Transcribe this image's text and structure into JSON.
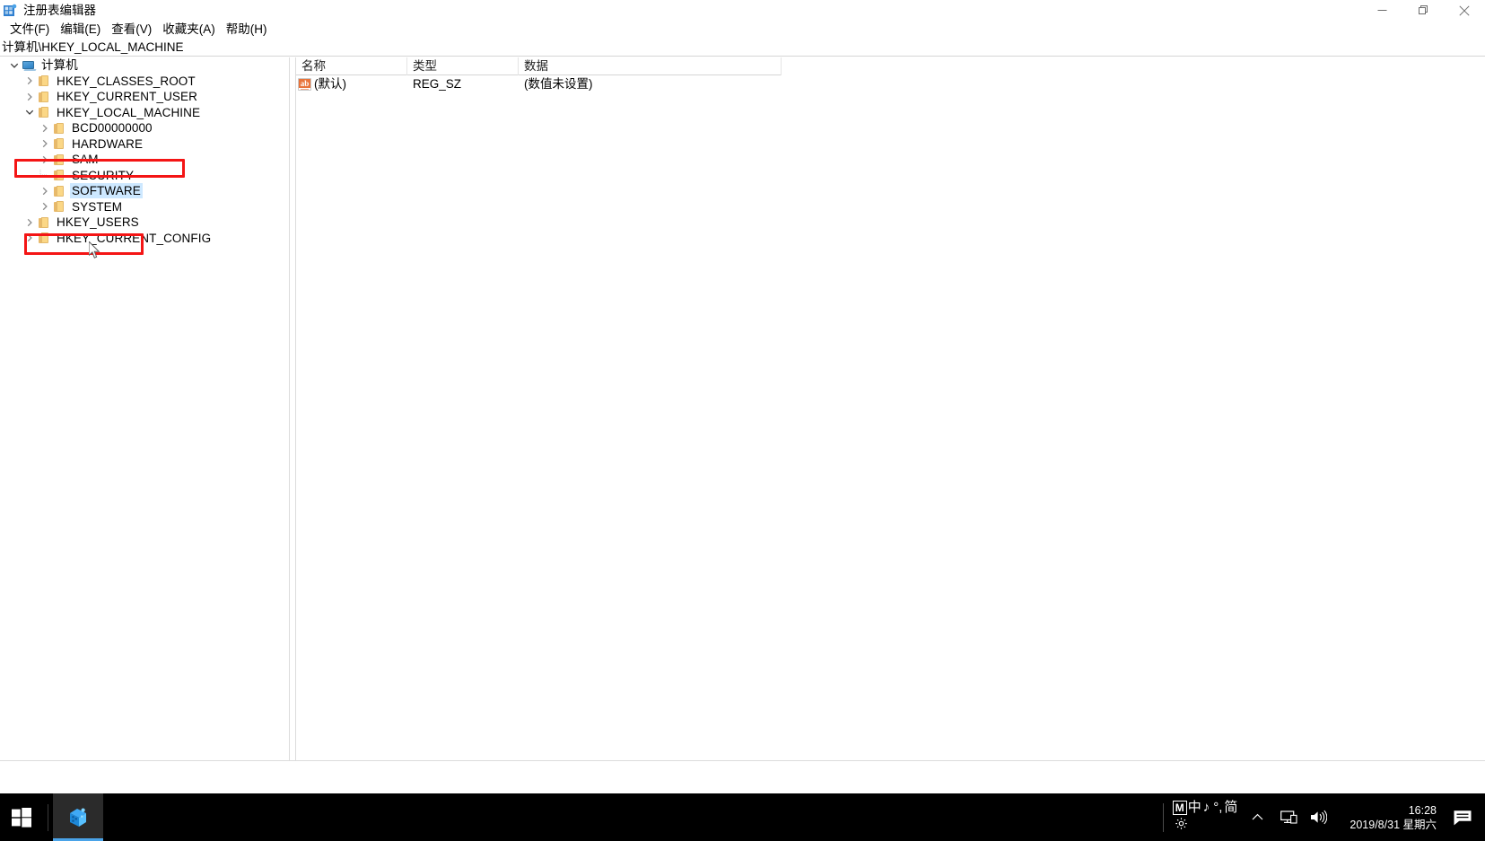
{
  "window": {
    "title": "注册表编辑器",
    "icon": "registry-editor-icon",
    "controls": {
      "minimize": "最小化",
      "restore": "还原",
      "close": "关闭"
    }
  },
  "menubar": {
    "items": [
      {
        "label": "文件(F)",
        "name": "menu-file"
      },
      {
        "label": "编辑(E)",
        "name": "menu-edit"
      },
      {
        "label": "查看(V)",
        "name": "menu-view"
      },
      {
        "label": "收藏夹(A)",
        "name": "menu-favorites"
      },
      {
        "label": "帮助(H)",
        "name": "menu-help"
      }
    ]
  },
  "address": {
    "path": "计算机\\HKEY_LOCAL_MACHINE"
  },
  "tree": {
    "nodes": [
      {
        "label": "计算机",
        "depth": 0,
        "icon": "computer-icon",
        "expanded": true,
        "has_children": true,
        "selected": false
      },
      {
        "label": "HKEY_CLASSES_ROOT",
        "depth": 1,
        "icon": "folder-icon",
        "expanded": false,
        "has_children": true,
        "selected": false
      },
      {
        "label": "HKEY_CURRENT_USER",
        "depth": 1,
        "icon": "folder-icon",
        "expanded": false,
        "has_children": true,
        "selected": false
      },
      {
        "label": "HKEY_LOCAL_MACHINE",
        "depth": 1,
        "icon": "folder-icon",
        "expanded": true,
        "has_children": true,
        "selected": false
      },
      {
        "label": "BCD00000000",
        "depth": 2,
        "icon": "folder-icon",
        "expanded": false,
        "has_children": true,
        "selected": false
      },
      {
        "label": "HARDWARE",
        "depth": 2,
        "icon": "folder-icon",
        "expanded": false,
        "has_children": true,
        "selected": false
      },
      {
        "label": "SAM",
        "depth": 2,
        "icon": "folder-icon",
        "expanded": false,
        "has_children": true,
        "selected": false
      },
      {
        "label": "SECURITY",
        "depth": 2,
        "icon": "folder-icon",
        "expanded": false,
        "has_children": false,
        "selected": false
      },
      {
        "label": "SOFTWARE",
        "depth": 2,
        "icon": "folder-icon",
        "expanded": false,
        "has_children": true,
        "selected": true
      },
      {
        "label": "SYSTEM",
        "depth": 2,
        "icon": "folder-icon",
        "expanded": false,
        "has_children": true,
        "selected": false
      },
      {
        "label": "HKEY_USERS",
        "depth": 1,
        "icon": "folder-icon",
        "expanded": false,
        "has_children": true,
        "selected": false
      },
      {
        "label": "HKEY_CURRENT_CONFIG",
        "depth": 1,
        "icon": "folder-icon",
        "expanded": false,
        "has_children": true,
        "selected": false
      }
    ]
  },
  "list": {
    "columns": [
      {
        "label": "名称",
        "name": "column-header-name"
      },
      {
        "label": "类型",
        "name": "column-header-type"
      },
      {
        "label": "数据",
        "name": "column-header-data"
      }
    ],
    "rows": [
      {
        "name": "(默认)",
        "type": "REG_SZ",
        "data": "(数值未设置)",
        "icon": "string-value-icon"
      }
    ]
  },
  "annotations": [
    {
      "name": "annotation-hklm",
      "target": "HKEY_LOCAL_MACHINE",
      "color": "#f41515"
    },
    {
      "name": "annotation-software",
      "target": "SOFTWARE",
      "color": "#f41515"
    }
  ],
  "taskbar": {
    "start_label": "开始",
    "apps": [
      {
        "label": "注册表编辑器",
        "icon": "registry-editor-icon",
        "active": true
      }
    ],
    "tray": {
      "ime": {
        "mode_box": "M",
        "language": "中",
        "music": "♪",
        "symbol": "°,",
        "script": "简",
        "settings_icon": "gear-icon"
      },
      "overflow_label": "显示隐藏的图标",
      "network_icon": "monitor-network-icon",
      "volume_icon": "speaker-icon",
      "time": "16:28",
      "date": "2019/8/31 星期六",
      "action_center_icon": "notification-icon"
    }
  },
  "colors": {
    "accent": "#4aa3e8",
    "selection": "#cde8ff",
    "annotation": "#f41515",
    "taskbar_bg": "#000000",
    "folder": "#fbd786"
  }
}
